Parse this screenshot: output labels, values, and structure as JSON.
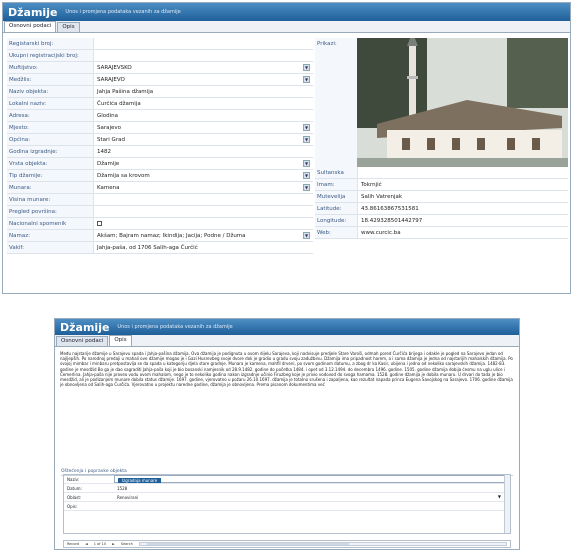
{
  "window1": {
    "title": "Džamije",
    "subtitle": "Unos i promjena podataka vezanih za džamije",
    "tabs": [
      "Osnovni podaci",
      "Opis"
    ],
    "form": [
      {
        "label": "Registarski broj:",
        "value": "",
        "dropdown": false
      },
      {
        "label": "Ukupni registracijski broj:",
        "value": "",
        "dropdown": false
      },
      {
        "label": "Muftijstvo:",
        "value": "SARAJEVSKO",
        "dropdown": true
      },
      {
        "label": "Medžlis:",
        "value": "SARAJEVO",
        "dropdown": true
      },
      {
        "label": "Naziv objekta:",
        "value": "Jahja Pašina džamija",
        "dropdown": false
      },
      {
        "label": "Lokalni naziv:",
        "value": "Čurčića džamija",
        "dropdown": false
      },
      {
        "label": "Adresa:",
        "value": "Glodina",
        "dropdown": false
      },
      {
        "label": "Mjesto:",
        "value": "Sarajevo",
        "dropdown": true
      },
      {
        "label": "Općina:",
        "value": "Stari Grad",
        "dropdown": true
      },
      {
        "label": "Godina izgradnje:",
        "value": "1482",
        "dropdown": false
      },
      {
        "label": "Vrsta objekta:",
        "value": "Džamije",
        "dropdown": true
      },
      {
        "label": "Tip džamije:",
        "value": "Džamija sa krovom",
        "dropdown": true
      },
      {
        "label": "Munara:",
        "value": "Kamena",
        "dropdown": true
      },
      {
        "label": "Visina munare:",
        "value": "",
        "dropdown": false
      },
      {
        "label": "Pregled površina:",
        "value": "",
        "dropdown": false
      },
      {
        "label": "Nacionalni spomenik",
        "value": "",
        "dropdown": false,
        "checkbox": true
      },
      {
        "label": "Namaz:",
        "value": "Akšam; Bajram namaz; Ikindija; Jacija; Podne / Džuma",
        "dropdown": true
      },
      {
        "label": "Vakif:",
        "value": "Jahja-paša, od 1706 Salih-aga Čurčić",
        "dropdown": false
      }
    ],
    "right": {
      "photo_label": "Prikazi:",
      "rows": [
        {
          "label": "Sultanska",
          "value": ""
        },
        {
          "label": "Imam:",
          "value": "Tokrnjić"
        },
        {
          "label": "Mutevelija",
          "value": "Salih Vatrenjak"
        },
        {
          "label": "Latitude:",
          "value": "43.86163867531581"
        },
        {
          "label": "Longitude:",
          "value": "18.429328501442797"
        },
        {
          "label": "Web:",
          "value": "www.curcic.ba"
        }
      ]
    }
  },
  "window2": {
    "title": "Džamije",
    "subtitle": "Unos i promjena podataka vezanih za džamije",
    "tabs": [
      "Osnovni podaci",
      "Opis"
    ],
    "description": "Među najstarije džamije u Sarajevu spada i Jahja-pašina džamija. Ova džamija je podignuta u ovom dijelu Sarajeva, koji nadvisuje predjele Stare Varoši, odmah pored Čurčića brijega i odakle je pogled na Sarajevo jedan od najljepših. Po narodnoj predaji u mahali ove džamije mogao je i Gazi Husrevbeg svoje dvore dok je gradio u gradu svoju zadužbinu. Džamija ima pripadnost harem, a i sama džamija je jedna od najstarijih mahalskih džamija. Po svojoj mimbar i minbaru pretpostavlja se da spada u kategoriju djela stare gradnje. Munara je kamena, mahfil drveni, po svom godinom datumu, a zbog dr ka Kasir, ubijena i jedna od nekoliko sarajevskih džamija. 1482-83. godine je mesdžid Bo ga je dao sagraditi Jahja-paša koji je bio bosanski namjesnik od 28.9.1482. godine do početka 1484. i opet od 3.12.1494. do decembra 1496. godine. 1505. godine džamija dobija ćesmu na uglu ulice i Čemerlina. Jahja-paša nije proveo vodu ovom mahalom, nego je to nekoliko godina nakon izgradnje učinio Firuzbeg koje je privio vodovod do svoga hamama. 1528. godine džamija je dobila munaru. U drvari do tada je bio mesdžid, ali je podizanjem munare dobila status džamije. 1697. godine, vjerovatno u požaru 26.10.1697. džamija je totalno srušena i zapaljena, kao rezultat napada princa Eugena Savojskog na Sarajevo. 1706. godine džamija je obnovljena od Salih-aga Čurčića. Vjerovatno u projektu naredne godine, džamija je obnovljena. Prema pisanom dokumentima već",
    "section_title": "Oštećenja i popravke objekta",
    "grid_rows": [
      {
        "label": "Naziv:",
        "value": "Izgradnja munare",
        "selected": true
      },
      {
        "label": "Datum:",
        "value": "1528",
        "selected": false
      },
      {
        "label": "Oblast:",
        "value": "Renovirani",
        "selected": false,
        "dropdown": true
      },
      {
        "label": "Opis:",
        "value": "",
        "selected": false
      }
    ],
    "pager": {
      "record": "Record",
      "position": "1 of 10",
      "search": "Search"
    }
  }
}
